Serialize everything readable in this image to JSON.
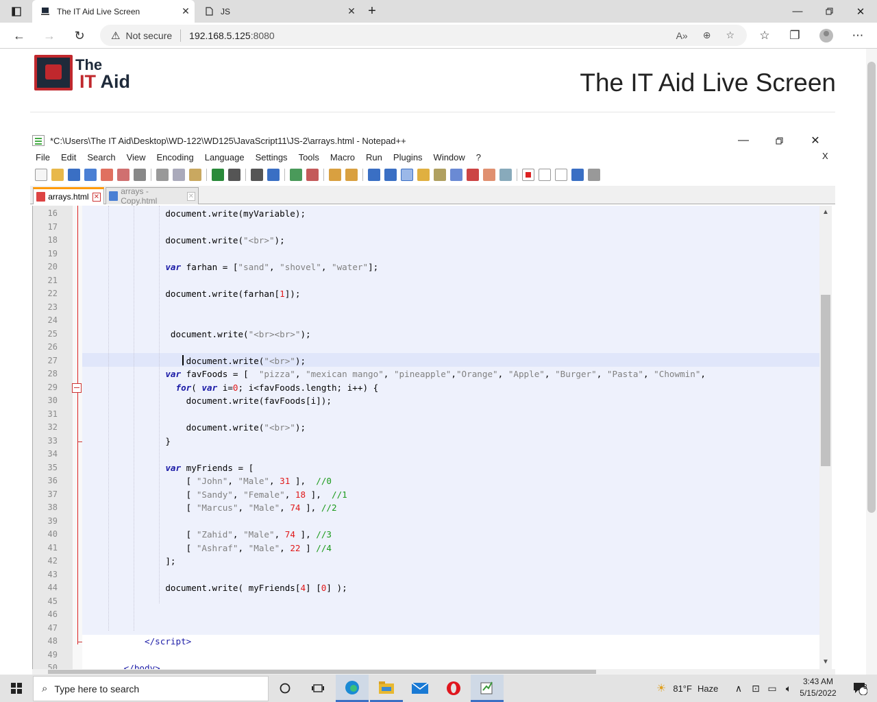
{
  "browser": {
    "tabs": [
      {
        "title": "The IT Aid Live Screen",
        "icon": "document-icon"
      },
      {
        "title": "JS",
        "icon": "page-icon"
      }
    ],
    "new_tab": "+",
    "security_label": "Not secure",
    "url_host": "192.168.5.125",
    "url_port": ":8080"
  },
  "page": {
    "logo_the": "The",
    "logo_it": "IT",
    "logo_aid": "Aid",
    "title": "The IT Aid Live Screen"
  },
  "npp": {
    "title": "*C:\\Users\\The IT Aid\\Desktop\\WD-122\\WD125\\JavaScript11\\JS-2\\arrays.html - Notepad++",
    "menu": [
      "File",
      "Edit",
      "Search",
      "View",
      "Encoding",
      "Language",
      "Settings",
      "Tools",
      "Macro",
      "Run",
      "Plugins",
      "Window",
      "?"
    ],
    "menu_close": "X",
    "file_tabs": [
      "arrays.html",
      "arrays - Copy.html"
    ],
    "line_numbers": [
      "16",
      "17",
      "18",
      "19",
      "20",
      "21",
      "22",
      "23",
      "24",
      "25",
      "26",
      "27",
      "28",
      "29",
      "30",
      "31",
      "32",
      "33",
      "34",
      "35",
      "36",
      "37",
      "38",
      "39",
      "40",
      "41",
      "42",
      "43",
      "44",
      "45",
      "46",
      "47",
      "48",
      "49",
      "50"
    ]
  },
  "taskbar": {
    "search_placeholder": "Type here to search",
    "temperature": "81°F",
    "weather": "Haze",
    "time": "3:43 AM",
    "date": "5/15/2022",
    "notifications": "3"
  },
  "colors": {
    "accent_red": "#c0282d",
    "keyword_blue": "#1a1aa6",
    "number_red": "#e01818",
    "comment_green": "#1a9a1a"
  }
}
